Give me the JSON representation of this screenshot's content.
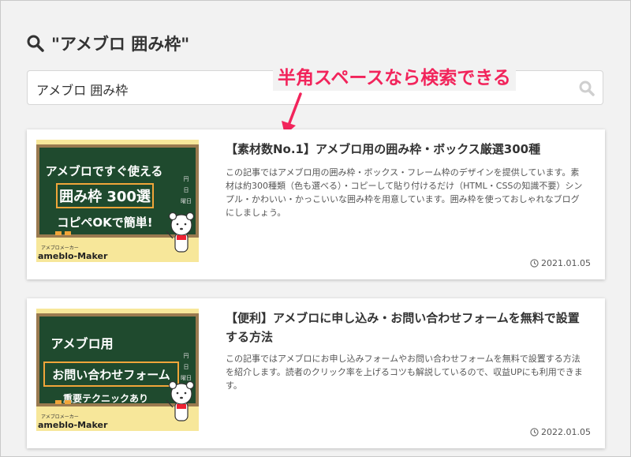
{
  "search": {
    "heading": "\"アメブロ 囲み枠\"",
    "query": "アメブロ 囲み枠"
  },
  "annotation": {
    "text": "半角スペースなら検索できる",
    "color": "#f2245b"
  },
  "articles": [
    {
      "title": "【素材数No.1】アメブロ用の囲み枠・ボックス厳選300種",
      "excerpt": "この記事ではアメブロ用の囲み枠・ボックス・フレーム枠のデザインを提供しています。素材は約300種類（色も選べる）・コピーして貼り付けるだけ（HTML・CSSの知識不要）シンプル・かわいい・かっこいいな囲み枠を用意しています。囲み枠を使っておしゃれなブログにしましょう。",
      "date": "2021.01.05",
      "thumbnail": {
        "line1": "アメブロですぐ使える",
        "line2": "囲み枠 300選",
        "line3": "コピペOKで簡単!",
        "side_text": [
          "円",
          "日",
          "曜日"
        ],
        "brand_small": "アメブロメーカー",
        "brand": "ameblo-Maker"
      }
    },
    {
      "title": "【便利】アメブロに申し込み・お問い合わせフォームを無料で設置する方法",
      "excerpt": "この記事ではアメブロにお申し込みフォームやお問い合わせフォームを無料で設置する方法を紹介します。読者のクリック率を上げるコツも解説しているので、収益UPにも利用できます。",
      "date": "2022.01.05",
      "thumbnail": {
        "line1": "アメブロ用",
        "line2": "お問い合わせフォーム",
        "line3": "重要テクニックあり",
        "side_text": [
          "円",
          "日",
          "曜日"
        ],
        "brand_small": "アメブロメーカー",
        "brand": "ameblo-Maker"
      }
    }
  ],
  "colors": {
    "board_green": "#1f4a2e",
    "board_frame": "#f7e79a",
    "accent_orange": "#f0a53a"
  }
}
